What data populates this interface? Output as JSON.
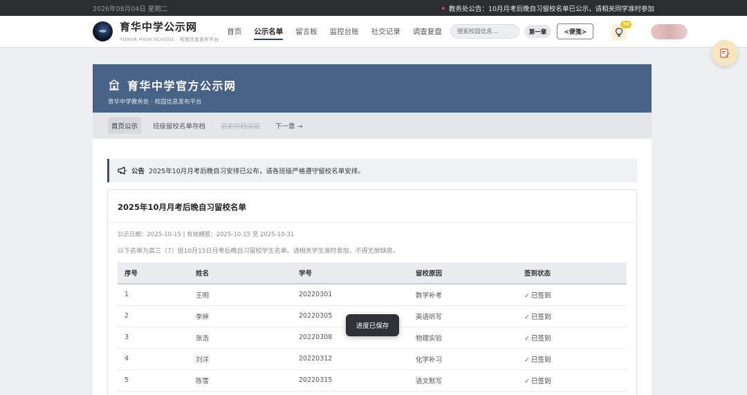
{
  "topbar": {
    "date": "2026年08月04日 星期二",
    "notice": "教务处公告：10月月考后晚自习留校名单已公示，请相关同学准时参加"
  },
  "header": {
    "brand_cn": "育华中学公示网",
    "brand_en": "YUHUA HIGH SCHOOL · 校园信息发布平台",
    "nav": [
      {
        "label": "首页",
        "active": false
      },
      {
        "label": "公示名单",
        "active": true
      },
      {
        "label": "留言板",
        "active": false
      },
      {
        "label": "监控台账",
        "active": false
      },
      {
        "label": "社交记录",
        "active": false
      },
      {
        "label": "调查复盘",
        "active": false
      }
    ],
    "search_placeholder": "搜索校园信息...",
    "chapter_label": "第一章",
    "notes_label": "<便笺>",
    "hint_count": "30"
  },
  "banner": {
    "title": "育华中学官方公示网",
    "subtitle": "育华中学教务处 · 校园信息发布平台"
  },
  "tabs": [
    {
      "label": "首页公示",
      "state": "active"
    },
    {
      "label": "班级留校名单存档",
      "state": "normal"
    },
    {
      "label": "历史存档浏览",
      "state": "disabled"
    },
    {
      "label": "下一章 →",
      "state": "normal"
    }
  ],
  "announcement": {
    "label": "公告",
    "text": "2025年10月月考后晚自习安排已公布，请各班级严格遵守留校名单安排。"
  },
  "list": {
    "title": "2025年10月月考后晚自习留校名单",
    "meta": "公示日期：2025-10-15 | 有效期限：2025-10-15 至 2025-10-31",
    "description": "以下名单为高三（7）班10月15日月考后晚自习留校学生名单。请相关学生准时参加，不得无故缺席。",
    "columns": [
      "序号",
      "姓名",
      "学号",
      "留校原因",
      "签到状态"
    ],
    "rows": [
      {
        "no": "1",
        "name": "王明",
        "id": "20220301",
        "reason": "数学补考",
        "status": "已签到"
      },
      {
        "no": "2",
        "name": "李婷",
        "id": "20220305",
        "reason": "英语听写",
        "status": "已签到"
      },
      {
        "no": "3",
        "name": "张浩",
        "id": "20220308",
        "reason": "物理实验",
        "status": "已签到"
      },
      {
        "no": "4",
        "name": "刘洋",
        "id": "20220312",
        "reason": "化学补习",
        "status": "已签到"
      },
      {
        "no": "5",
        "name": "陈雪",
        "id": "20220315",
        "reason": "语文默写",
        "status": "已签到"
      }
    ]
  },
  "toast": "进度已保存",
  "colors": {
    "banner": "#476386",
    "topbar": "#2b2d30",
    "check": "#3e7d3f",
    "hint_badge": "#f0c419"
  }
}
